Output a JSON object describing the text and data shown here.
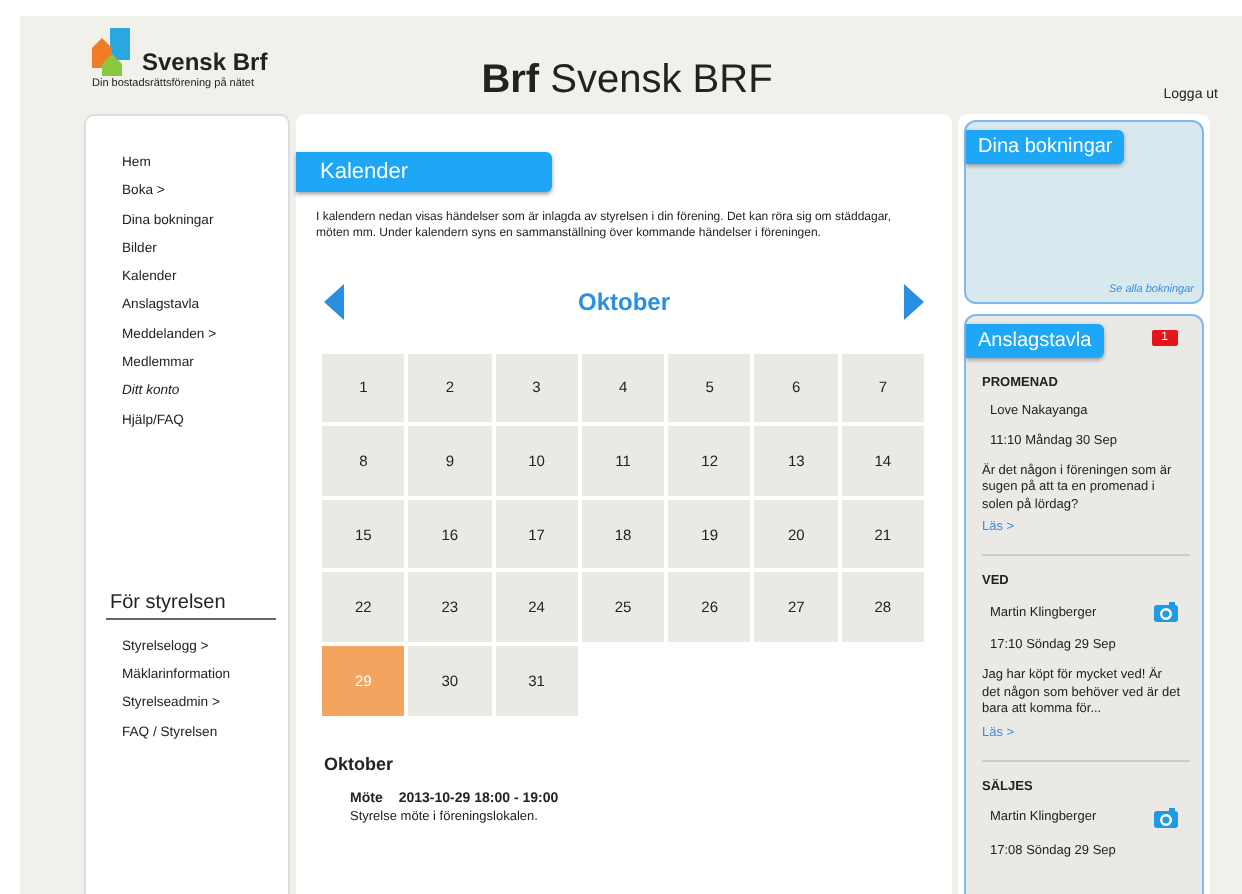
{
  "logo": {
    "name": "Svensk Brf",
    "tagline": "Din bostadsrättsförening på nätet"
  },
  "site_title": {
    "bold": "Brf",
    "rest": "Svensk BRF"
  },
  "logout": "Logga ut",
  "nav": [
    {
      "label": "Hem",
      "italic": false
    },
    {
      "label": "Boka >",
      "italic": false
    },
    {
      "label": "Dina bokningar",
      "italic": false
    },
    {
      "label": "Bilder",
      "italic": false
    },
    {
      "label": "Kalender",
      "italic": false
    },
    {
      "label": "Anslagstavla",
      "italic": false
    },
    {
      "label": "Meddelanden >",
      "italic": false
    },
    {
      "label": "Medlemmar",
      "italic": false
    },
    {
      "label": "Ditt konto",
      "italic": true
    },
    {
      "label": "Hjälp/FAQ",
      "italic": false
    }
  ],
  "board_nav": {
    "title": "För styrelsen",
    "items": [
      "Styrelselogg >",
      "Mäklarinformation",
      "Styrelseadmin >",
      "FAQ / Styrelsen"
    ]
  },
  "calendar": {
    "heading": "Kalender",
    "intro": "I kalendern nedan visas händelser som är inlagda av styrelsen i din förening. Det kan röra sig om städdagar, möten mm. Under kalendern syns en sammanställning över kommande händelser i föreningen.",
    "month": "Oktober",
    "days": [
      {
        "day": "1",
        "selected": false
      },
      {
        "day": "2",
        "selected": false
      },
      {
        "day": "3",
        "selected": false
      },
      {
        "day": "4",
        "selected": false
      },
      {
        "day": "5",
        "selected": false
      },
      {
        "day": "6",
        "selected": false
      },
      {
        "day": "7",
        "selected": false
      },
      {
        "day": "8",
        "selected": false
      },
      {
        "day": "9",
        "selected": false
      },
      {
        "day": "10",
        "selected": false
      },
      {
        "day": "11",
        "selected": false
      },
      {
        "day": "12",
        "selected": false
      },
      {
        "day": "13",
        "selected": false
      },
      {
        "day": "14",
        "selected": false
      },
      {
        "day": "15",
        "selected": false
      },
      {
        "day": "16",
        "selected": false
      },
      {
        "day": "17",
        "selected": false
      },
      {
        "day": "18",
        "selected": false
      },
      {
        "day": "19",
        "selected": false
      },
      {
        "day": "20",
        "selected": false
      },
      {
        "day": "21",
        "selected": false
      },
      {
        "day": "22",
        "selected": false
      },
      {
        "day": "23",
        "selected": false
      },
      {
        "day": "24",
        "selected": false
      },
      {
        "day": "25",
        "selected": false
      },
      {
        "day": "26",
        "selected": false
      },
      {
        "day": "27",
        "selected": false
      },
      {
        "day": "28",
        "selected": false
      },
      {
        "day": "29",
        "selected": true
      },
      {
        "day": "30",
        "selected": false
      },
      {
        "day": "31",
        "selected": false
      }
    ],
    "events_month": "Oktober",
    "events": [
      {
        "type": "Möte",
        "when": "2013-10-29 18:00 - 19:00",
        "description": "Styrelse möte i föreningslokalen."
      }
    ]
  },
  "bookings": {
    "heading": "Dina bokningar",
    "link": "Se alla bokningar"
  },
  "board": {
    "heading": "Anslagstavla",
    "badge": "1",
    "posts": [
      {
        "title": "PROMENAD",
        "author": "Love Nakayanga",
        "time": "11:10 Måndag 30 Sep",
        "text": "Är det någon i föreningen som är sugen på att ta en promenad i solen på lördag?",
        "more": "Läs >",
        "has_image": false
      },
      {
        "title": "VED",
        "author": "Martin Klingberger",
        "time": "17:10 Söndag 29 Sep",
        "text": "Jag har köpt för mycket ved! Är det någon som behöver ved är det bara att komma för...",
        "more": "Läs >",
        "has_image": true
      },
      {
        "title": "SÄLJES",
        "author": "Martin Klingberger",
        "time": "17:08 Söndag 29 Sep",
        "has_image": true
      }
    ]
  }
}
